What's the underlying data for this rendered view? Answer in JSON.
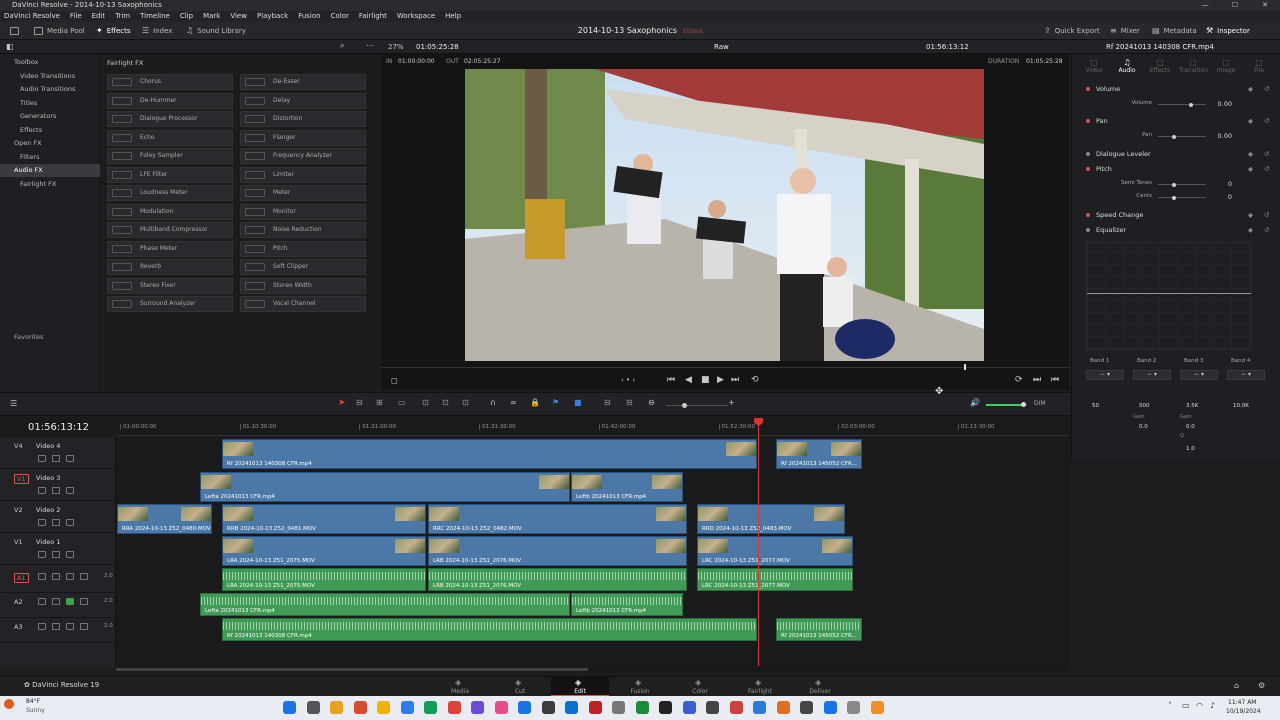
{
  "window": {
    "title": "DaVinci Resolve - 2014-10-13 Saxophonics",
    "controls": [
      "—",
      "☐",
      "✕"
    ]
  },
  "menu": [
    "DaVinci Resolve",
    "File",
    "Edit",
    "Trim",
    "Timeline",
    "Clip",
    "Mark",
    "View",
    "Playback",
    "Fusion",
    "Color",
    "Fairlight",
    "Workspace",
    "Help"
  ],
  "toolbar": {
    "media_pool": "Media Pool",
    "effects": "Effects",
    "index": "Index",
    "sound_library": "Sound Library",
    "project_title": "2014-10-13 Saxophonics",
    "edited": "Edited",
    "quick_export": "Quick Export",
    "mixer": "Mixer",
    "metadata": "Metadata",
    "inspector": "Inspector"
  },
  "viewer_bar": {
    "zoom": "27%",
    "timecode_left": "01:05:25:28",
    "mode": "Raw",
    "timecode_right": "01:56:13:12",
    "clip_name": "Rf 20241013 140308 CFR.mp4"
  },
  "in_out": {
    "in_label": "IN",
    "in": "01:00:00:00",
    "out_label": "OUT",
    "out": "02:05:25:27",
    "duration_label": "DURATION",
    "duration": "01:05:25:28"
  },
  "left_tree": [
    {
      "label": "Toolbox",
      "indent": 0
    },
    {
      "label": "Video Transitions",
      "indent": 1
    },
    {
      "label": "Audio Transitions",
      "indent": 1
    },
    {
      "label": "Titles",
      "indent": 1
    },
    {
      "label": "Generators",
      "indent": 1
    },
    {
      "label": "Effects",
      "indent": 1
    },
    {
      "label": "Open FX",
      "indent": 0
    },
    {
      "label": "Filters",
      "indent": 1
    },
    {
      "label": "Audio FX",
      "indent": 0,
      "selected": true
    },
    {
      "label": "Fairlight FX",
      "indent": 1
    }
  ],
  "favorites_label": "Favorites",
  "fx_header": "Fairlight FX",
  "fx_left": [
    "Chorus",
    "De-Hummer",
    "Dialogue Processor",
    "Echo",
    "Foley Sampler",
    "LFE Filter",
    "Loudness Meter",
    "Modulation",
    "Multiband Compressor",
    "Phase Meter",
    "Reverb",
    "Stereo Fixer",
    "Surround Analyzer"
  ],
  "fx_right": [
    "De-Esser",
    "Delay",
    "Distortion",
    "Flanger",
    "Frequency Analyzer",
    "Limiter",
    "Meter",
    "Monitor",
    "Noise Reduction",
    "Pitch",
    "Soft Clipper",
    "Stereo Width",
    "Vocal Channel"
  ],
  "inspector": {
    "tabs": [
      "Video",
      "Audio",
      "Effects",
      "Transition",
      "Image",
      "File"
    ],
    "volume": {
      "title": "Volume",
      "label": "Volume",
      "value": "0.00"
    },
    "pan": {
      "title": "Pan",
      "label": "Pan",
      "value": "0.00"
    },
    "dialogue_leveler": "Dialogue Leveler",
    "pitch": {
      "title": "Pitch",
      "semitones_label": "Semi Tones",
      "semitones": "0",
      "cents_label": "Cents",
      "cents": "0"
    },
    "speed_change": "Speed Change",
    "equalizer": "Equalizer",
    "bands": [
      {
        "name": "Band 1",
        "freq_label": "Freq",
        "freq": "50"
      },
      {
        "name": "Band 2",
        "freq_label": "Freq",
        "freq": "500",
        "gain_label": "Gain",
        "gain": "0.0"
      },
      {
        "name": "Band 3",
        "freq_label": "Freq",
        "freq": "3.5K",
        "gain_label": "Gain",
        "gain": "0.0",
        "q_label": "Q",
        "q": "1.0"
      },
      {
        "name": "Band 4",
        "freq_label": "Freq",
        "freq": "10.0K"
      }
    ],
    "band3_gain": "0.0"
  },
  "timeline": {
    "timecode": "01:56:13:12",
    "ruler": [
      "01:00:00:00",
      "01:10:30:00",
      "01:21:00:00",
      "01:31:30:00",
      "01:42:00:00",
      "01:52:30:00",
      "02:03:00:00",
      "02:13:30:00"
    ],
    "dim": "DIM",
    "tracks": [
      {
        "tag": "V4",
        "name": "Video 4"
      },
      {
        "tag": "V1",
        "name": "Video 3",
        "patched": true
      },
      {
        "tag": "V2",
        "name": "Video 2"
      },
      {
        "tag": "V1",
        "name": "Video 1"
      },
      {
        "tag": "A1",
        "name": "",
        "patched": true,
        "level": "2.0"
      },
      {
        "tag": "A2",
        "name": "",
        "level": "2.0"
      },
      {
        "tag": "A3",
        "name": "",
        "level": "2.0"
      }
    ],
    "v4_clips": [
      "Rf 20241013 140308 CFR.mp4",
      "Rf 20241013 145052 CFR..."
    ],
    "v3_clips": [
      "Lefta 20241013 CFR.mp4",
      "Leftb 20241013 CFR.mp4"
    ],
    "v2_clips": [
      "RRA 2024-10-13 Z52_0480.MOV",
      "RRB 2024-10-13 Z52_0481.MOV",
      "RRC 2024-10-13 Z52_0482.MOV",
      "RRD 2024-10-13 Z52_0483.MOV"
    ],
    "v1_clips": [
      "LRA 2024-10-13 Z51_2075.MOV",
      "LRB 2024-10-13 Z51_2076.MOV",
      "LRC 2024-10-13 Z51_2077.MOV"
    ],
    "a1_clips": [
      "LRA 2024-10-13 Z51_2075.MOV",
      "LRB 2024-10-13 Z51_2076.MOV",
      "LRC 2024-10-13 Z51_2077.MOV"
    ],
    "a2_clips": [
      "Lefta 20241013 CFR.mp4",
      "Leftb 20241013 CFR.mp4"
    ],
    "a3_clips": [
      "Rf 20241013 140308 CFR.mp4",
      "Rf 20241013 145052 CFR..."
    ]
  },
  "pages": [
    "Media",
    "Cut",
    "Edit",
    "Fusion",
    "Color",
    "Fairlight",
    "Deliver"
  ],
  "brand": "DaVinci Resolve 19",
  "taskbar": {
    "weather_temp": "84°F",
    "weather_desc": "Sunny",
    "time": "11:47 AM",
    "date": "10/19/2024"
  }
}
